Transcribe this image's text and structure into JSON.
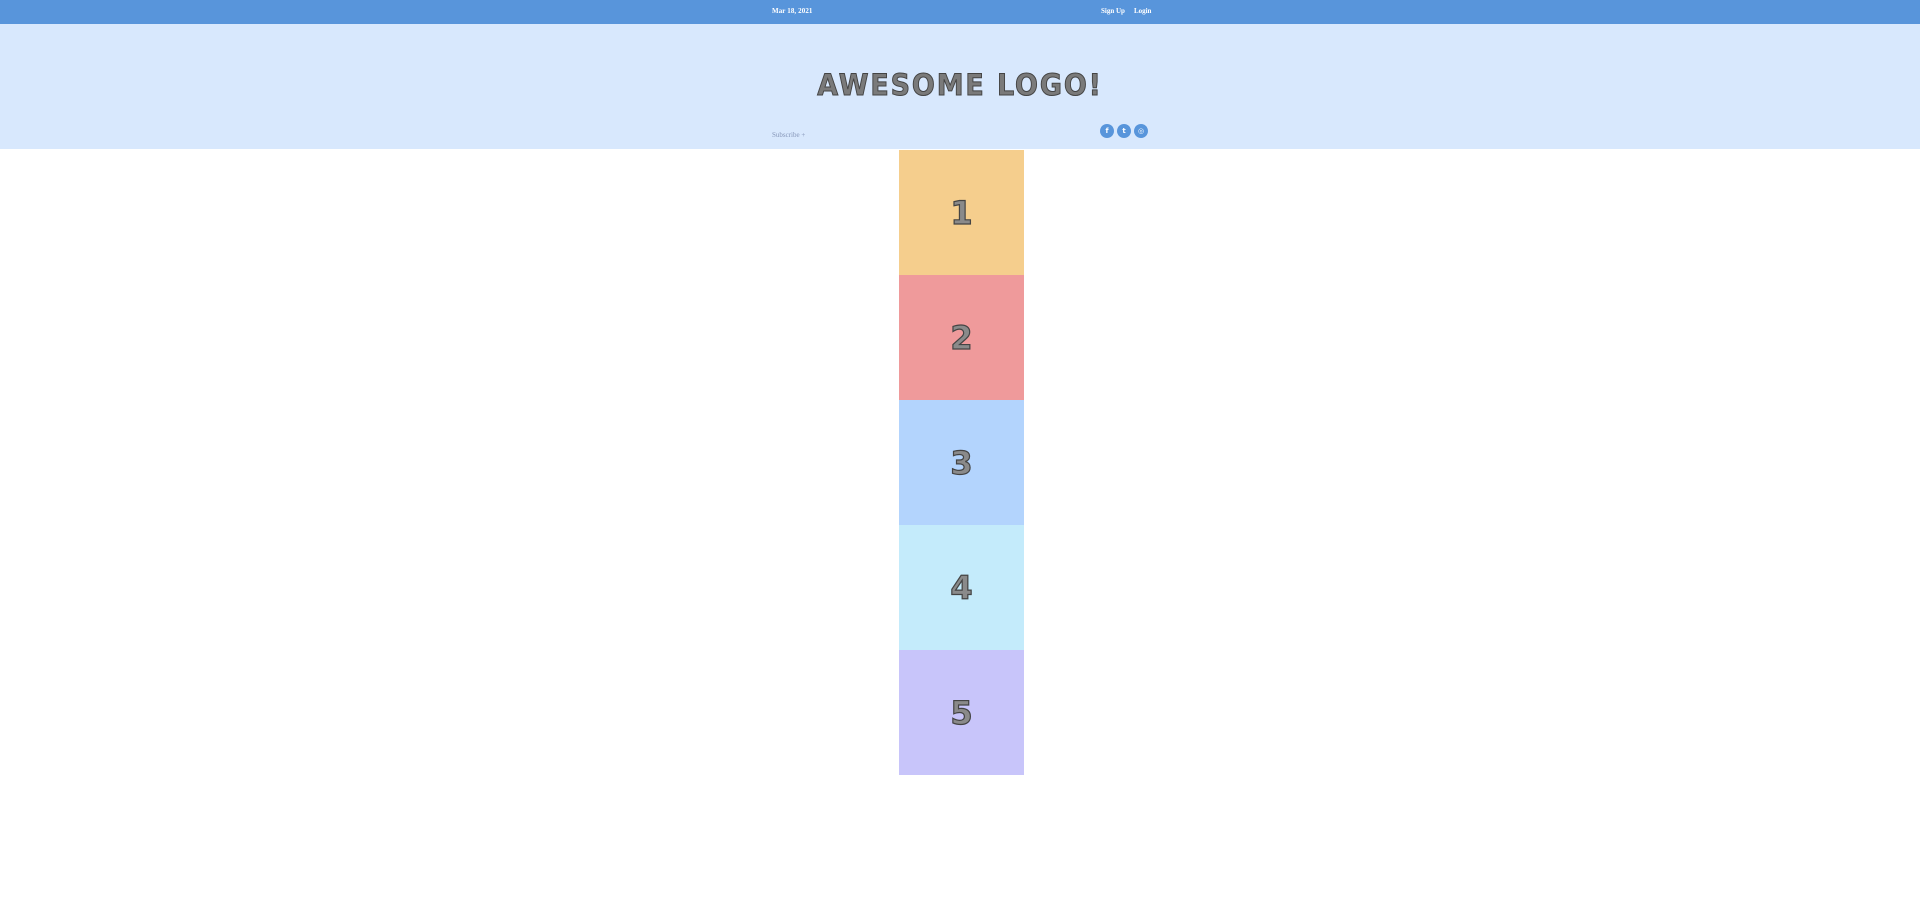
{
  "topbar": {
    "date": "Mar 18, 2021",
    "signup_label": "Sign Up",
    "login_label": "Login",
    "background": "#5895db"
  },
  "header": {
    "logo_text": "AWESOME LOGO!",
    "subscribe_label": "Subscribe +",
    "background": "#d8e8fd",
    "social": [
      {
        "icon": "facebook-icon",
        "glyph": "f"
      },
      {
        "icon": "twitter-icon",
        "glyph": "t"
      },
      {
        "icon": "instagram-icon",
        "glyph": "◎"
      }
    ]
  },
  "boxes": [
    {
      "label": "1",
      "color": "#f5ce8d"
    },
    {
      "label": "2",
      "color": "#ef9a9b"
    },
    {
      "label": "3",
      "color": "#b3d4fd"
    },
    {
      "label": "4",
      "color": "#c4ebfb"
    },
    {
      "label": "5",
      "color": "#c8c5fa"
    }
  ]
}
